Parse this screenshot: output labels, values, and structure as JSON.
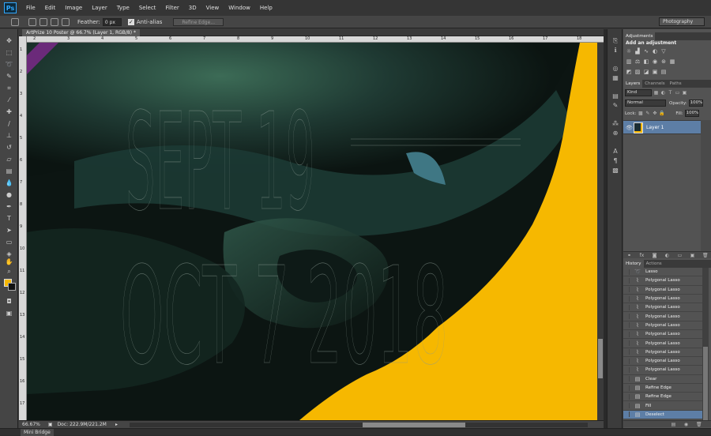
{
  "app": {
    "logo": "Ps",
    "menu": [
      "File",
      "Edit",
      "Image",
      "Layer",
      "Type",
      "Select",
      "Filter",
      "3D",
      "View",
      "Window",
      "Help"
    ],
    "workspace": "Photography"
  },
  "options": {
    "feather_label": "Feather:",
    "feather_value": "0 px",
    "antialias_label": "Anti-alias",
    "refine_edge": "Refine Edge..."
  },
  "document": {
    "tab_title": "ArtPrize 10 Poster @ 66.7% (Layer 1, RGB/8) *",
    "zoom": "66.67%",
    "doc_size": "Doc: 222.9M/221.2M",
    "ruler_h": [
      "2",
      "3",
      "4",
      "5",
      "6",
      "7",
      "8",
      "9",
      "10",
      "11",
      "12",
      "13",
      "14",
      "15",
      "16",
      "17",
      "18"
    ],
    "ruler_v": [
      "1",
      "2",
      "3",
      "4",
      "5",
      "6",
      "7",
      "8",
      "9",
      "10",
      "11",
      "12",
      "13",
      "14",
      "15",
      "16",
      "17"
    ],
    "poster_line1": "SEPT 19",
    "poster_line2": "OCT 7 2018"
  },
  "colors": {
    "foreground": "#f6b800",
    "background": "#111111",
    "yellow": "#f6b800",
    "selection": "#5d7ea6"
  },
  "adjustments": {
    "tab": "Adjustments",
    "title": "Add an adjustment"
  },
  "layers": {
    "tabs": [
      "Layers",
      "Channels",
      "Paths"
    ],
    "kind": "Kind",
    "blend": "Normal",
    "opacity_label": "Opacity:",
    "opacity": "100%",
    "lock_label": "Lock:",
    "fill_label": "Fill:",
    "fill": "100%",
    "items": [
      {
        "name": "Layer 1"
      }
    ]
  },
  "history": {
    "tabs": [
      "History",
      "Actions"
    ],
    "items": [
      {
        "label": "Lasso",
        "icon": "lasso-icon"
      },
      {
        "label": "Polygonal Lasso",
        "icon": "polygonal-lasso-icon"
      },
      {
        "label": "Polygonal Lasso",
        "icon": "polygonal-lasso-icon"
      },
      {
        "label": "Polygonal Lasso",
        "icon": "polygonal-lasso-icon"
      },
      {
        "label": "Polygonal Lasso",
        "icon": "polygonal-lasso-icon"
      },
      {
        "label": "Polygonal Lasso",
        "icon": "polygonal-lasso-icon"
      },
      {
        "label": "Polygonal Lasso",
        "icon": "polygonal-lasso-icon"
      },
      {
        "label": "Polygonal Lasso",
        "icon": "polygonal-lasso-icon"
      },
      {
        "label": "Polygonal Lasso",
        "icon": "polygonal-lasso-icon"
      },
      {
        "label": "Polygonal Lasso",
        "icon": "polygonal-lasso-icon"
      },
      {
        "label": "Polygonal Lasso",
        "icon": "polygonal-lasso-icon"
      },
      {
        "label": "Polygonal Lasso",
        "icon": "polygonal-lasso-icon"
      },
      {
        "label": "Clear",
        "icon": "history-state-icon"
      },
      {
        "label": "Refine Edge",
        "icon": "history-state-icon"
      },
      {
        "label": "Refine Edge",
        "icon": "history-state-icon"
      },
      {
        "label": "Fill",
        "icon": "history-state-icon"
      },
      {
        "label": "Deselect",
        "icon": "history-state-icon"
      }
    ]
  },
  "bottom": {
    "mini_bridge": "Mini Bridge"
  }
}
